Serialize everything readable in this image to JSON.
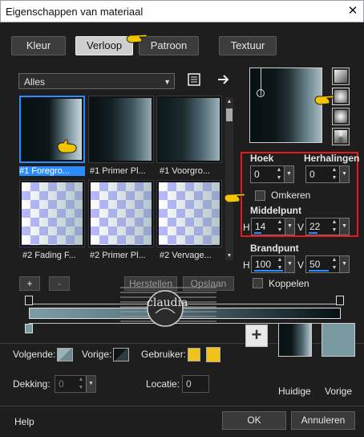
{
  "window": {
    "title": "Eigenschappen van materiaal",
    "close_glyph": "✕"
  },
  "tabs": [
    {
      "label": "Kleur",
      "active": false
    },
    {
      "label": "Verloop",
      "active": true
    },
    {
      "label": "Patroon",
      "active": false
    },
    {
      "label": "Textuur",
      "active": false
    }
  ],
  "preset_filter": {
    "value": "Alles"
  },
  "icons": {
    "library": "library-icon",
    "arrow": "arrow-right-icon",
    "pointer": "pointing-hand-icon"
  },
  "gradients": [
    {
      "label": "#1 Foregro...",
      "selected": true
    },
    {
      "label": "#1 Primer Pl...",
      "selected": false
    },
    {
      "label": "#1 Voorgro...",
      "selected": false
    },
    {
      "label": "#2 Fading F...",
      "selected": false
    },
    {
      "label": "#2 Primer Pl...",
      "selected": false
    },
    {
      "label": "#2 Vervage...",
      "selected": false
    }
  ],
  "gradient_style": {
    "labels": {
      "angle": "Hoek",
      "repeats": "Herhalingen",
      "invert": "Omkeren",
      "center": "Middelpunt",
      "focal": "Brandpunt",
      "link": "Koppelen",
      "h": "H",
      "v": "V"
    },
    "angle": "0",
    "repeats": "0",
    "invert_checked": false,
    "center_h": "14",
    "center_v": "22",
    "focal_h": "100",
    "focal_v": "50",
    "link_checked": false
  },
  "editor": {
    "add": "+",
    "remove": "-",
    "reset": "Herstellen",
    "save": "Opslaan"
  },
  "watermark": {
    "text": "claudia"
  },
  "stops": {
    "labels": {
      "next": "Volgende:",
      "prev": "Vorige:",
      "user": "Gebruiker:"
    },
    "user_color": "#f1c21b"
  },
  "opacity": {
    "label": "Dekking:",
    "value": "0"
  },
  "location": {
    "label": "Locatie:",
    "value": "0"
  },
  "current": {
    "add": "+",
    "current_label": "Huidige",
    "previous_label": "Vorige",
    "previous_color": "#7a9aa2"
  },
  "footer": {
    "help": "Help",
    "ok": "OK",
    "cancel": "Annuleren"
  }
}
